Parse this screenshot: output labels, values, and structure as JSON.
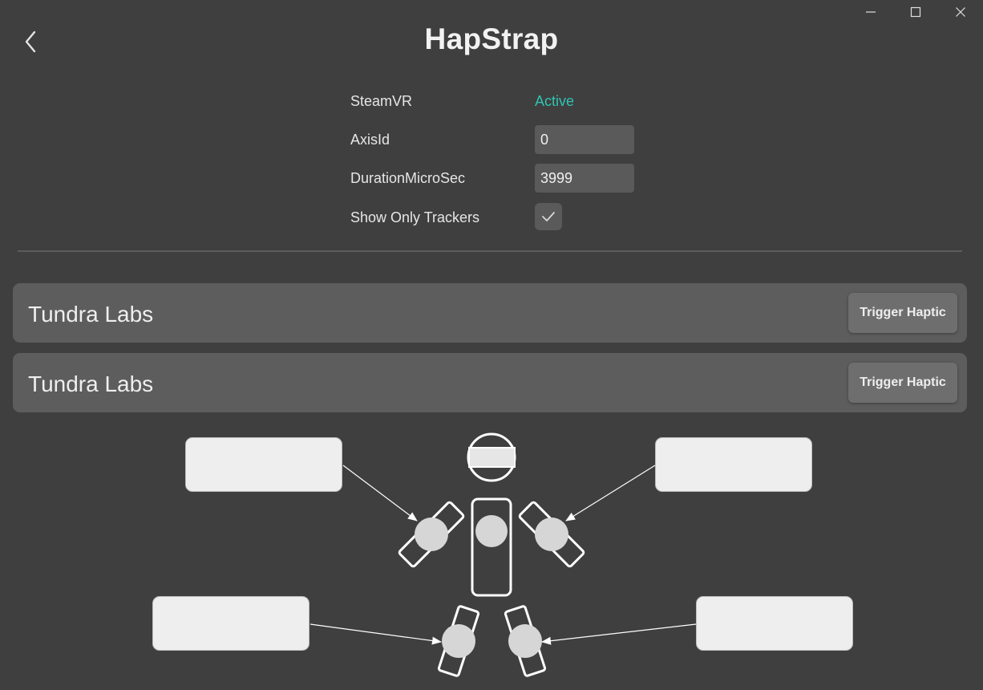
{
  "window": {
    "minimize_icon": "minimize-icon",
    "maximize_icon": "maximize-icon",
    "close_icon": "close-icon"
  },
  "header": {
    "back_icon": "chevron-left-icon",
    "title": "HapStrap"
  },
  "settings": {
    "steamvr": {
      "label": "SteamVR",
      "value": "Active",
      "value_color": "#2fc4b2"
    },
    "axis_id": {
      "label": "AxisId",
      "value": "0"
    },
    "duration": {
      "label": "DurationMicroSec",
      "value": "3999"
    },
    "show_only_trackers": {
      "label": "Show Only Trackers",
      "checked": true,
      "icon": "checkmark-icon"
    }
  },
  "devices": [
    {
      "name": "Tundra Labs",
      "button_label": "Trigger Haptic"
    },
    {
      "name": "Tundra Labs",
      "button_label": "Trigger Haptic"
    }
  ],
  "body_diagram": {
    "slots": [
      {
        "position": "upper-left",
        "label": ""
      },
      {
        "position": "upper-right",
        "label": ""
      },
      {
        "position": "lower-left",
        "label": ""
      },
      {
        "position": "lower-right",
        "label": ""
      }
    ]
  }
}
